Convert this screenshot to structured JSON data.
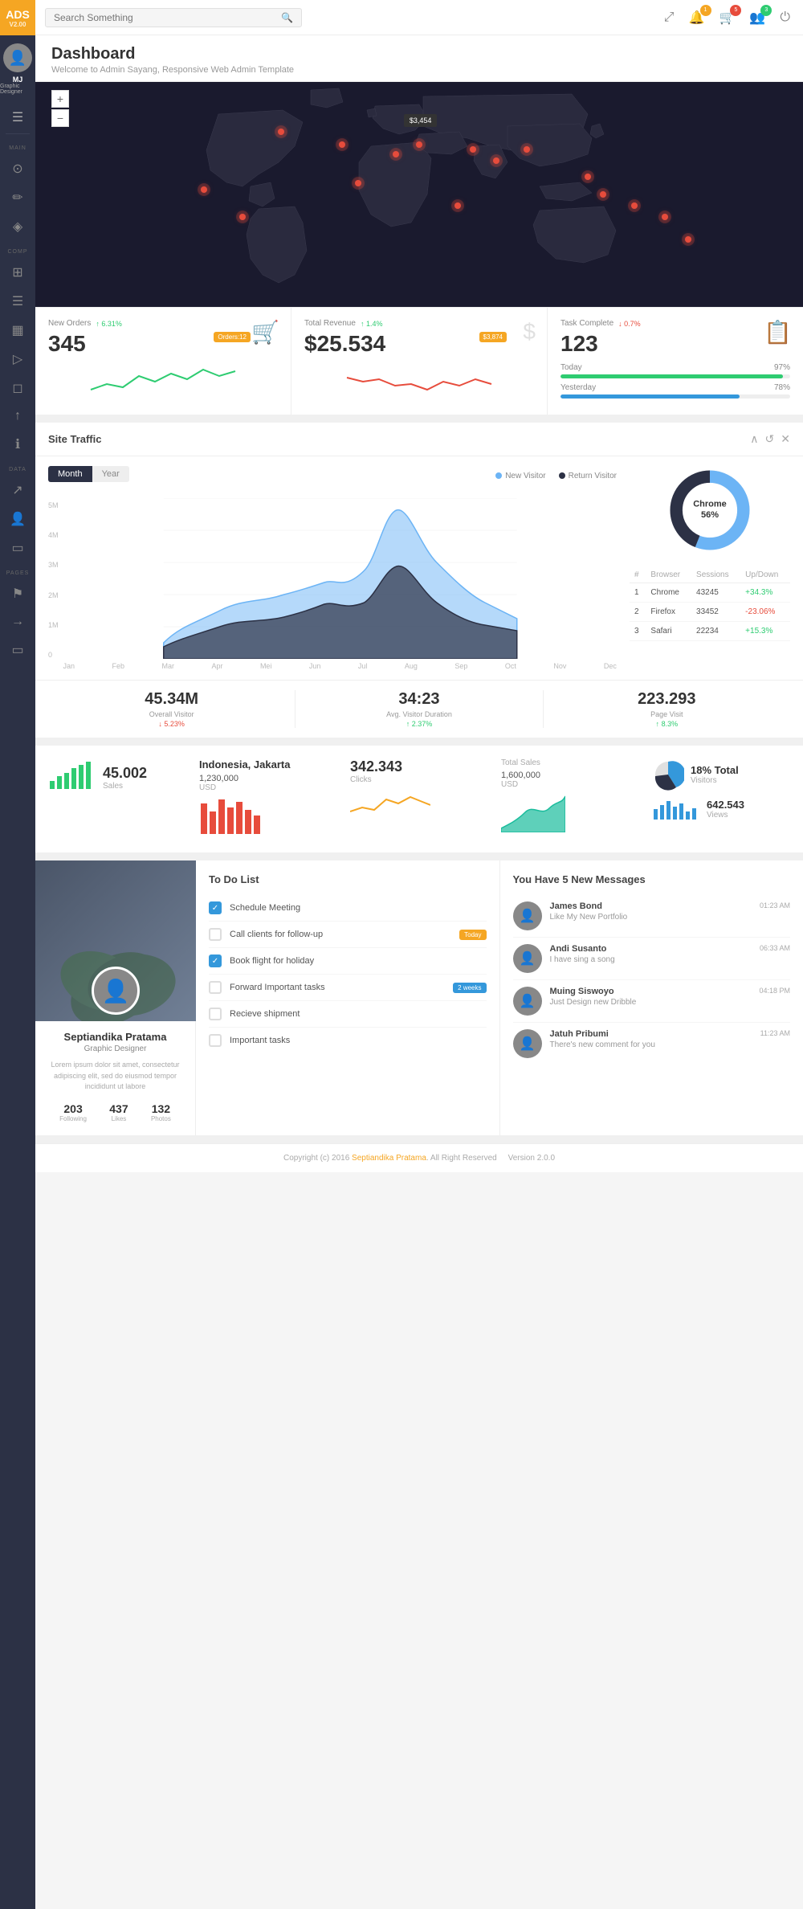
{
  "app": {
    "name": "ADS",
    "version": "V2.00",
    "logo_color": "#f5a623"
  },
  "header": {
    "search_placeholder": "Search Something",
    "notifications_count": "1",
    "cart_count": "5",
    "user_count": "3"
  },
  "sidebar": {
    "user": {
      "initials": "MJ",
      "name": "MJ",
      "role": "Graphic Designer"
    },
    "sections": {
      "main_label": "MAIN",
      "comp_label": "COMP",
      "data_label": "DATA",
      "pages_label": "PAGES"
    }
  },
  "page": {
    "title": "Dashboard",
    "subtitle": "Welcome to Admin Sayang, Responsive Web Admin Template"
  },
  "stats": {
    "new_orders": {
      "label": "New Orders",
      "change": "6.31%",
      "change_direction": "up",
      "value": "345",
      "badge": "Orders:12"
    },
    "total_revenue": {
      "label": "Total Revenue",
      "change": "1.4%",
      "change_direction": "up",
      "value": "$25.534",
      "badge": "$3,874"
    },
    "task_complete": {
      "label": "Task Complete",
      "change": "0.7%",
      "change_direction": "down",
      "value": "123",
      "today_label": "Today",
      "today_pct": "97",
      "yesterday_label": "Yesterday",
      "yesterday_pct": "78"
    }
  },
  "site_traffic": {
    "title": "Site Traffic",
    "toggle": {
      "month": "Month",
      "year": "Year"
    },
    "legend": {
      "new_visitor": "New Visitor",
      "return_visitor": "Return Visitor"
    },
    "y_labels": [
      "5M",
      "4M",
      "3M",
      "2M",
      "1M",
      "0"
    ],
    "x_labels": [
      "Jan",
      "Feb",
      "Mar",
      "Apr",
      "Mei",
      "Jun",
      "Jul",
      "Aug",
      "Sep",
      "Oct",
      "Nov",
      "Dec"
    ],
    "chart": {
      "browser_label": "Chrome",
      "browser_pct": "56%"
    },
    "browsers": [
      {
        "num": "1",
        "name": "Chrome",
        "sessions": "43245",
        "change": "+34.3%",
        "dir": "up"
      },
      {
        "num": "2",
        "name": "Firefox",
        "sessions": "33452",
        "change": "-23.06%",
        "dir": "down"
      },
      {
        "num": "3",
        "name": "Safari",
        "sessions": "22234",
        "change": "+15.3%",
        "dir": "up"
      }
    ],
    "browser_table_headers": {
      "num": "#",
      "browser": "Browser",
      "sessions": "Sessions",
      "updown": "Up/Down"
    },
    "overall_visitor": {
      "value": "45.34M",
      "label": "Overall Visitor",
      "change": "5.23%",
      "dir": "down"
    },
    "avg_duration": {
      "value": "34:23",
      "label": "Avg. Visitor Duration",
      "change": "2.37%",
      "dir": "up"
    },
    "page_visit": {
      "value": "223.293",
      "label": "Page Visit",
      "change": "8.3%",
      "dir": "up"
    }
  },
  "mini_stats": {
    "sales": {
      "value": "45.002",
      "label": "Sales"
    },
    "location": {
      "name": "Indonesia, Jakarta",
      "amount": "1,230,000",
      "currency": "USD"
    },
    "clicks": {
      "value": "342.343",
      "label": "Clicks"
    },
    "total_sales": {
      "label": "Total Sales",
      "amount": "1,600,000",
      "currency": "USD"
    },
    "visitors": {
      "pct": "18% Total",
      "label": "Visitors"
    },
    "views": {
      "value": "642.543",
      "label": "Views"
    }
  },
  "profile": {
    "name": "Septiandika Pratama",
    "role": "Graphic Designer",
    "bio": "Lorem ipsum dolor sit amet, consectetur adipiscing elit, sed do eiusmod tempor incididunt ut labore",
    "stats": {
      "following": {
        "value": "203",
        "label": "Following"
      },
      "likes": {
        "value": "437",
        "label": "Likes"
      },
      "photos": {
        "value": "132",
        "label": "Photos"
      }
    }
  },
  "todo": {
    "title": "To Do List",
    "items": [
      {
        "text": "Schedule Meeting",
        "checked": true,
        "badge": null
      },
      {
        "text": "Call clients for follow-up",
        "checked": false,
        "badge": "Today",
        "badge_type": "orange"
      },
      {
        "text": "Book flight for holiday",
        "checked": true,
        "badge": null
      },
      {
        "text": "Forward Important tasks",
        "checked": false,
        "badge": "2 weeks",
        "badge_type": "blue"
      },
      {
        "text": "Recieve shipment",
        "checked": false,
        "badge": null
      },
      {
        "text": "Important tasks",
        "checked": false,
        "badge": null
      }
    ]
  },
  "messages": {
    "title": "You Have 5 New Messages",
    "items": [
      {
        "name": "James Bond",
        "time": "01:23 AM",
        "text": "Like My New Portfolio"
      },
      {
        "name": "Andi Susanto",
        "time": "06:33 AM",
        "text": "I have sing a song"
      },
      {
        "name": "Muing Siswoyo",
        "time": "04:18 PM",
        "text": "Just Design new Dribble"
      },
      {
        "name": "Jatuh Pribumi",
        "time": "11:23 AM",
        "text": "There's new comment for you"
      }
    ]
  },
  "footer": {
    "text": "Copyright (c) 2016 ",
    "link_text": "Septiandika Pratama",
    "text2": ". All Right Reserved",
    "version": "Version 2.0.0"
  }
}
